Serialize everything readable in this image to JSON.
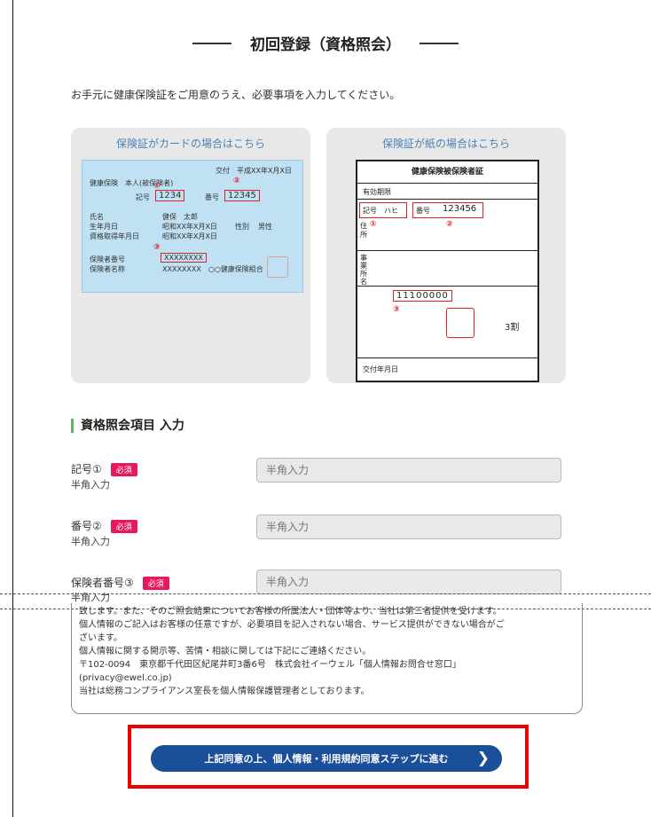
{
  "page": {
    "title": "初回登録（資格照会）",
    "intro": "お手元に健康保険証をご用意のうえ、必要事項を入力してください。"
  },
  "card_panel": {
    "title": "保険証がカードの場合はこちら",
    "issue_date": "交付　平成XX年X月X日",
    "type_label": "健康保険　本人(被保険者)",
    "kigou_label": "記号",
    "kigou_value": "1234",
    "bangou_label": "番号",
    "bangou_value": "12345",
    "marker1": "①",
    "marker2": "②",
    "marker3": "③",
    "name_label": "氏名",
    "name_value": "健保　太郎",
    "birth_label": "生年月日",
    "birth_value": "昭和XX年X月X日",
    "sex_label": "性別",
    "sex_value": "男性",
    "acq_label": "資格取得年月日",
    "acq_value": "昭和XX年X月X日",
    "insurer_no_label": "保険者番号",
    "insurer_no_value": "XXXXXXXX",
    "insurer_name_label": "保険者名称",
    "insurer_name_value": "XXXXXXXX　○○健康保険組合"
  },
  "paper_panel": {
    "title": "保険証が紙の場合はこちら",
    "heading": "健康保険被保険者証",
    "validity": "有効期限",
    "kigou_label": "記号",
    "kigou_value": "ハヒ",
    "bangou_label": "番号",
    "bangou_value": "123456",
    "marker1": "①",
    "marker2": "②",
    "marker3": "③",
    "addr_label": "住所",
    "place_label": "事業所名",
    "insurer_no_value": "11100000",
    "rate_value": "3割",
    "issue_label": "交付年月日"
  },
  "form": {
    "section_title": "資格照会項目 入力",
    "required_badge": "必須",
    "fields": [
      {
        "label": "記号①",
        "sub": "半角入力",
        "placeholder": "半角入力"
      },
      {
        "label": "番号②",
        "sub": "半角入力",
        "placeholder": "半角入力"
      },
      {
        "label": "保険者番号③",
        "sub": "半角入力",
        "placeholder": "半角入力"
      }
    ]
  },
  "privacy": {
    "lines": [
      "致します。また、そのご照会結果についてお客様の所属法人・団体等より、当社は第三者提供を受けます。",
      "個人情報のご記入はお客様の任意ですが、必要項目を記入されない場合、サービス提供ができない場合がご",
      "ざいます。",
      "個人情報に関する開示等、苦情・相談に関しては下記にご連絡ください。",
      "〒102-0094　東京都千代田区紀尾井町3番6号　株式会社イーウェル「個人情報お問合せ窓口」",
      "(privacy@ewel.co.jp)",
      "当社は総務コンプライアンス室長を個人情報保護管理者としております。"
    ]
  },
  "cta": {
    "label": "上記同意の上、個人情報・利用規約同意ステップに進む",
    "chevron": "❯"
  },
  "colors": {
    "accent_blue": "#1c4f99",
    "required_pink": "#e6185f",
    "highlight_red": "#e00",
    "section_green": "#5cb85c"
  }
}
